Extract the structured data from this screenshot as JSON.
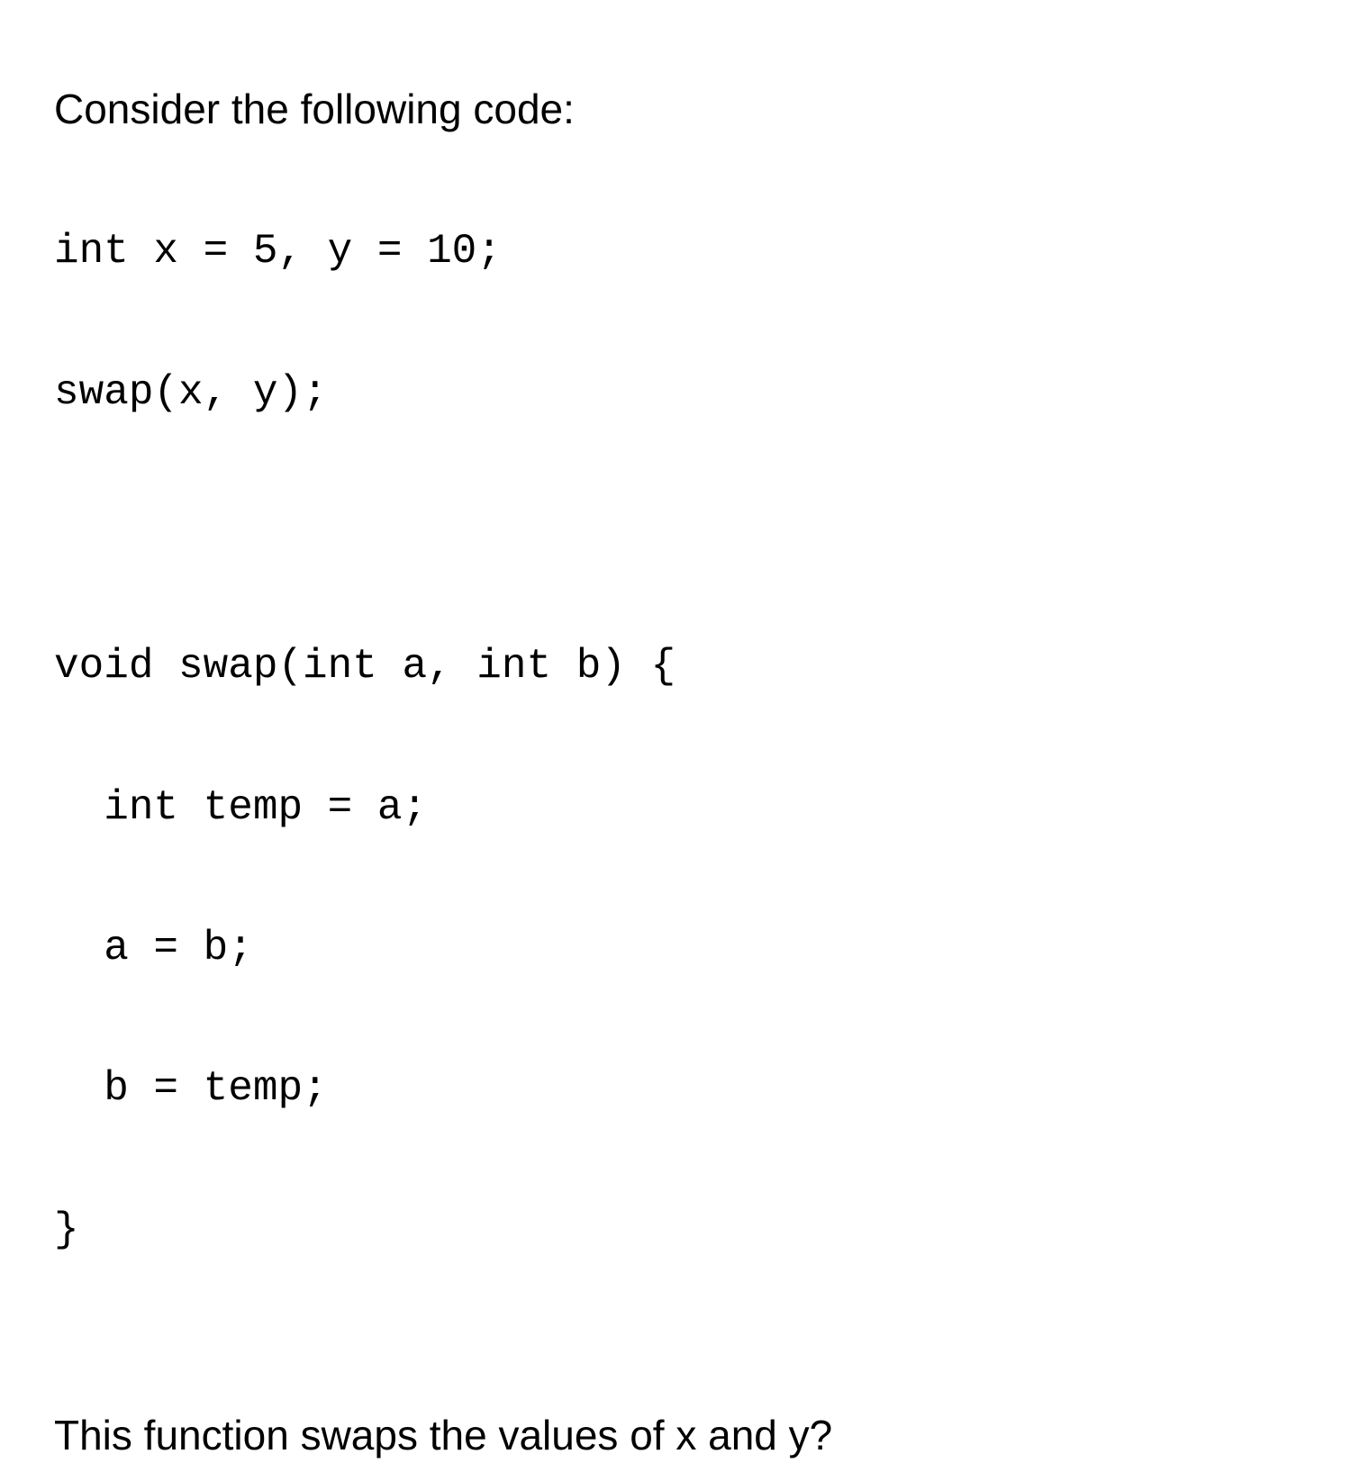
{
  "intro": "Consider the following code:",
  "code1_line1": "int x = 5, y = 10;",
  "code1_line2": "swap(x, y);",
  "code2_line1": "void swap(int a, int b) {",
  "code2_line2": "  int temp = a;",
  "code2_line3": "  a = b;",
  "code2_line4": "  b = temp;",
  "code2_line5": "}",
  "question": "This function swaps the values of x and y?"
}
